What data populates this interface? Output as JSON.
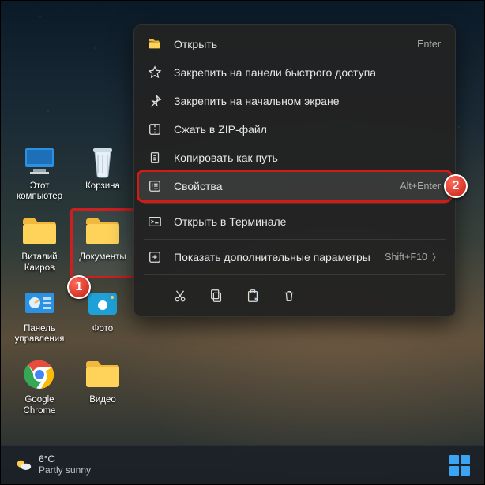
{
  "desktop_icons": [
    {
      "key": "this-pc",
      "label": "Этот\nкомпьютер"
    },
    {
      "key": "recycle",
      "label": "Корзина"
    },
    {
      "key": "user-folder",
      "label": "Виталий\nКаиров"
    },
    {
      "key": "documents",
      "label": "Документы",
      "selected": true,
      "callout": "1"
    },
    {
      "key": "control",
      "label": "Панель\nуправления"
    },
    {
      "key": "photos",
      "label": "Фото"
    },
    {
      "key": "chrome",
      "label": "Google\nChrome"
    },
    {
      "key": "video",
      "label": "Видео"
    }
  ],
  "context_menu": {
    "items": [
      {
        "icon": "folder-open",
        "label": "Открыть",
        "shortcut": "Enter"
      },
      {
        "icon": "star",
        "label": "Закрепить на панели быстрого доступа"
      },
      {
        "icon": "pin",
        "label": "Закрепить на начальном экране"
      },
      {
        "icon": "zip",
        "label": "Сжать в ZIP-файл"
      },
      {
        "icon": "copy-path",
        "label": "Копировать как путь"
      },
      {
        "icon": "properties",
        "label": "Свойства",
        "shortcut": "Alt+Enter",
        "highlight": true,
        "callout": "2"
      },
      {
        "sep": true
      },
      {
        "icon": "terminal",
        "label": "Открыть в Терминале"
      },
      {
        "sep": true
      },
      {
        "icon": "more",
        "label": "Показать дополнительные параметры",
        "shortcut": "Shift+F10"
      }
    ],
    "iconbar": [
      {
        "key": "cut",
        "name": "cut-icon"
      },
      {
        "key": "copy",
        "name": "copy-icon"
      },
      {
        "key": "paste",
        "name": "paste-icon"
      },
      {
        "key": "delete",
        "name": "trash-icon"
      }
    ]
  },
  "taskbar": {
    "temp": "6°C",
    "cond": "Partly sunny"
  }
}
